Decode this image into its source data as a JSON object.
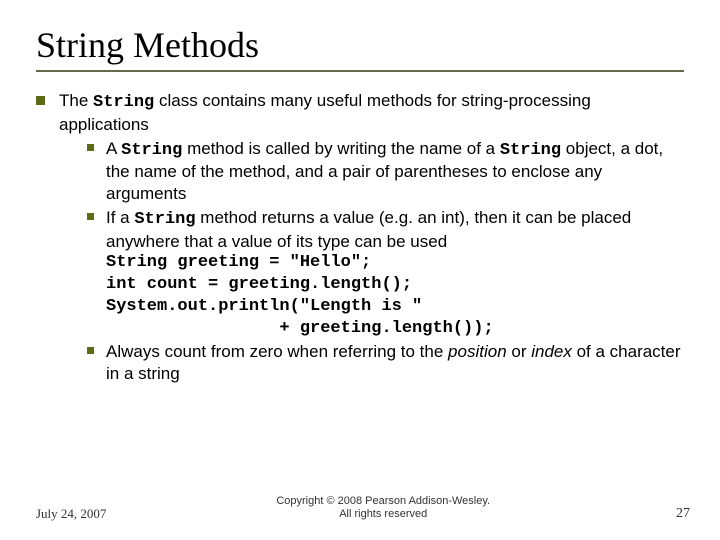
{
  "title": "String Methods",
  "bullets": {
    "main_pre": "The ",
    "main_mono": "String",
    "main_post": " class contains many useful methods for string-processing applications",
    "sub1_a": "A ",
    "sub1_b": "String",
    "sub1_c": " method is called by writing the name of a ",
    "sub1_d": "String",
    "sub1_e": " object, a dot, the name of the method, and a pair of parentheses to enclose any arguments",
    "sub2_a": "If a ",
    "sub2_b": "String",
    "sub2_c": " method returns a value (e.g. an int), then it can be placed anywhere that a value of its type can be used",
    "code1": "String greeting = \"Hello\";",
    "code2": "int count = greeting.length();",
    "code3": "System.out.println(\"Length is \"",
    "code4": "                 + greeting.length());",
    "sub3_a": "Always count from zero when referring to the ",
    "sub3_b": "position",
    "sub3_c": " or ",
    "sub3_d": "index",
    "sub3_e": " of a character in a string"
  },
  "footer": {
    "date": "July 24, 2007",
    "copyright_line1": "Copyright © 2008 Pearson Addison-Wesley.",
    "copyright_line2": "All rights reserved",
    "page": "27"
  }
}
